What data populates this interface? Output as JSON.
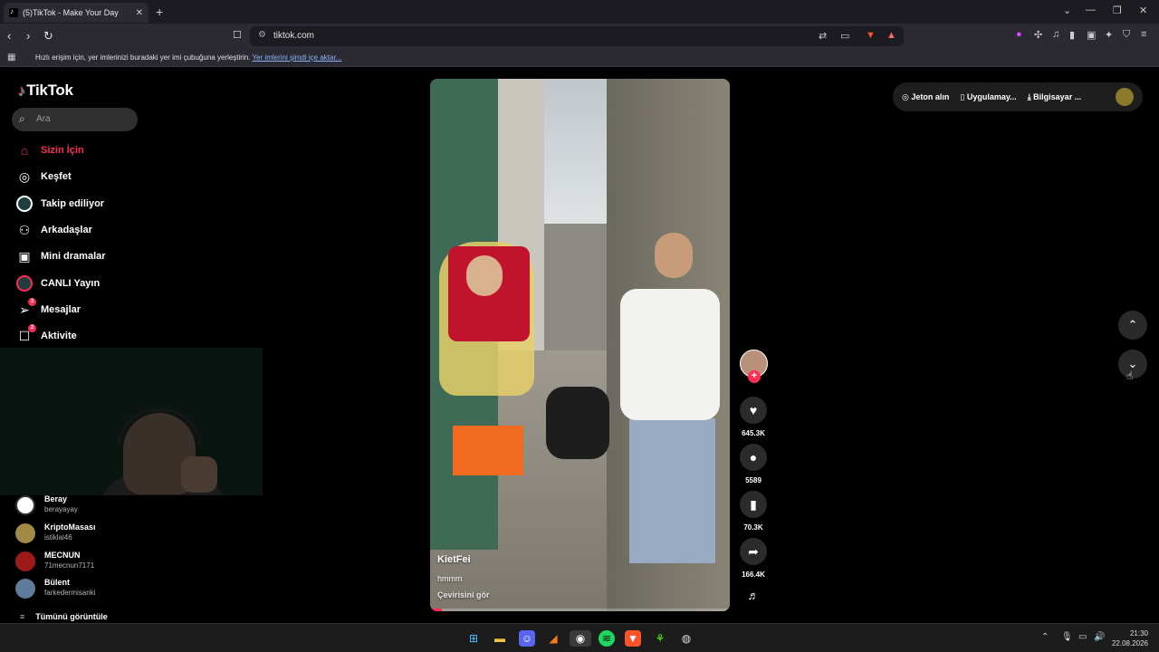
{
  "browser": {
    "tab_title": "(5)TikTok - Make Your Day",
    "url": "tiktok.com",
    "bookmark_message": "Hızlı erişim için, yer imlerinizi buradaki yer imi çubuğuna yerleştirin.",
    "bookmark_link": "Yer imlerini şimdi içe aktar..."
  },
  "tiktok": {
    "logo": "TikTok",
    "search_placeholder": "Ara",
    "nav": [
      {
        "label": "Sizin İçin",
        "icon": "home-icon"
      },
      {
        "label": "Keşfet",
        "icon": "compass-icon"
      },
      {
        "label": "Takip ediliyor",
        "icon": "following-icon"
      },
      {
        "label": "Arkadaşlar",
        "icon": "friends-icon"
      },
      {
        "label": "Mini dramalar",
        "icon": "drama-icon"
      },
      {
        "label": "CANLI Yayın",
        "icon": "live-icon"
      },
      {
        "label": "Mesajlar",
        "icon": "messages-icon",
        "badge": "3"
      },
      {
        "label": "Aktivite",
        "icon": "activity-icon",
        "badge": "2"
      }
    ],
    "following": [
      {
        "name": "Beray",
        "username": "berayayay"
      },
      {
        "name": "KriptoMasası",
        "username": "istiklal46"
      },
      {
        "name": "MECNUN",
        "username": "71mecnun7171"
      },
      {
        "name": "Bülent",
        "username": "farkedermisanki"
      }
    ],
    "see_all": "Tümünü görüntüle",
    "top_bar": {
      "coins": "Jeton alın",
      "app": "Uygulamay...",
      "desktop": "Bilgisayar ..."
    },
    "video": {
      "author": "KietFei",
      "description": "hmmm",
      "translate": "Çevirisini gör",
      "progress": 0.04
    },
    "actions": {
      "likes": "645.3K",
      "comments": "5589",
      "saves": "70.3K",
      "shares": "166.4K"
    }
  },
  "taskbar": {
    "time": "21:30",
    "date": "22.08.2026"
  },
  "colors": {
    "accent": "#fe2c55",
    "browser_bg": "#2b2a33"
  }
}
